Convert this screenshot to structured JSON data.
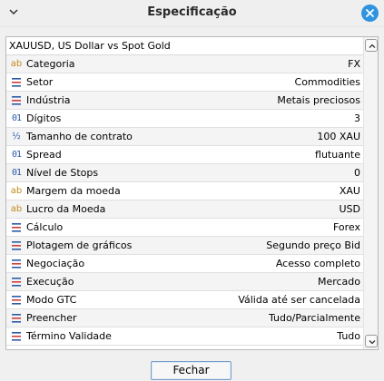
{
  "window": {
    "title": "Especificação"
  },
  "header": {
    "text": "XAUUSD, US Dollar vs Spot Gold"
  },
  "rows": [
    {
      "icon": "text-icon",
      "label": "Categoria",
      "value": "FX"
    },
    {
      "icon": "list-icon",
      "label": "Setor",
      "value": "Commodities"
    },
    {
      "icon": "list-icon",
      "label": "Indústria",
      "value": "Metais preciosos"
    },
    {
      "icon": "number-icon",
      "label": "Dígitos",
      "value": "3"
    },
    {
      "icon": "fraction-icon",
      "label": "Tamanho de contrato",
      "value": "100 XAU"
    },
    {
      "icon": "number-icon",
      "label": "Spread",
      "value": "flutuante"
    },
    {
      "icon": "number-icon",
      "label": "Nível de Stops",
      "value": "0"
    },
    {
      "icon": "text-icon",
      "label": "Margem da moeda",
      "value": "XAU"
    },
    {
      "icon": "text-icon",
      "label": "Lucro da Moeda",
      "value": "USD"
    },
    {
      "icon": "list-icon",
      "label": "Cálculo",
      "value": "Forex"
    },
    {
      "icon": "list-icon",
      "label": "Plotagem de gráficos",
      "value": "Segundo preço Bid"
    },
    {
      "icon": "list-icon",
      "label": "Negociação",
      "value": "Acesso completo"
    },
    {
      "icon": "list-icon",
      "label": "Execução",
      "value": "Mercado"
    },
    {
      "icon": "list-icon",
      "label": "Modo GTC",
      "value": "Válida até ser cancelada"
    },
    {
      "icon": "list-icon",
      "label": "Preencher",
      "value": "Tudo/Parcialmente"
    },
    {
      "icon": "list-icon",
      "label": "Término Validade",
      "value": "Tudo"
    }
  ],
  "icon_glyphs": {
    "text": "ab",
    "number": "01",
    "fraction": "½"
  },
  "footer": {
    "close_label": "Fechar"
  },
  "colors": {
    "close_button": "#2f93e0",
    "list_icon": "#2c5aa8",
    "list_icon_accent": "#d23c3c",
    "text_icon": "#c08a1a"
  }
}
